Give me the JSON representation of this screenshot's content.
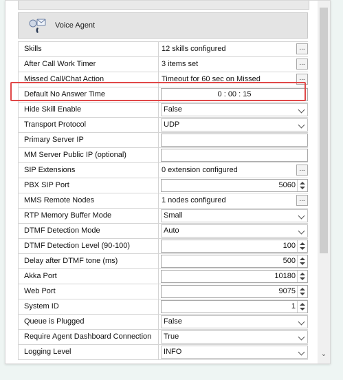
{
  "section": {
    "title": "Voice Agent",
    "icon": "voice-agent-icon"
  },
  "rows": [
    {
      "label": "Skills",
      "value": "12 skills configured"
    },
    {
      "label": "After Call Work Timer",
      "value": "3 items set"
    },
    {
      "label": "Missed Call/Chat Action",
      "value": "Timeout for 60 sec on Missed"
    },
    {
      "label": "Default No Answer Time",
      "value": "0 : 00 : 15"
    },
    {
      "label": "Hide Skill Enable",
      "value": "False"
    },
    {
      "label": "Transport Protocol",
      "value": "UDP"
    },
    {
      "label": "Primary Server IP",
      "value": ""
    },
    {
      "label": "MM Server Public IP (optional)",
      "value": ""
    },
    {
      "label": "SIP Extensions",
      "value": "0 extension configured"
    },
    {
      "label": "PBX SIP Port",
      "value": "5060"
    },
    {
      "label": "MMS Remote Nodes",
      "value": "1 nodes configured"
    },
    {
      "label": "RTP Memory Buffer Mode",
      "value": "Small"
    },
    {
      "label": "DTMF Detection Mode",
      "value": "Auto"
    },
    {
      "label": "DTMF Detection Level (90-100)",
      "value": "100"
    },
    {
      "label": "Delay after DTMF tone (ms)",
      "value": "500"
    },
    {
      "label": "Akka Port",
      "value": "10180"
    },
    {
      "label": "Web Port",
      "value": "9075"
    },
    {
      "label": "System ID",
      "value": "1"
    },
    {
      "label": "Queue is Plugged",
      "value": "False"
    },
    {
      "label": "Require Agent Dashboard Connection",
      "value": "True"
    },
    {
      "label": "Logging Level",
      "value": "INFO"
    }
  ],
  "buttons": {
    "ellipsis": "..."
  },
  "colors": {
    "highlight": "#e04848",
    "header_bg": "#e4e4e4"
  }
}
